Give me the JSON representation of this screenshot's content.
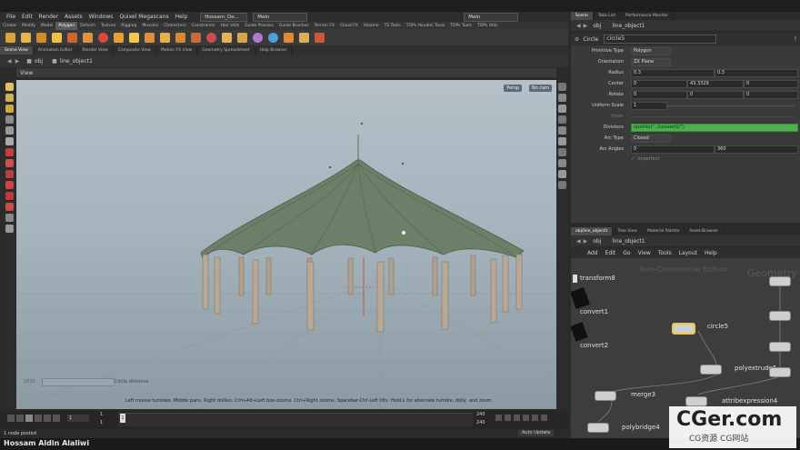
{
  "menu": {
    "items": [
      "File",
      "Edit",
      "Render",
      "Assets",
      "Windows",
      "Quixel Megascans",
      "Help"
    ],
    "scene_file": "Hossam_De...",
    "desktop": "Main",
    "search": "Main"
  },
  "shelf": {
    "tabs": [
      "Create",
      "Modify",
      "Model",
      "Polygon",
      "Deform",
      "Texture",
      "Rigging",
      "Muscles",
      "Characters",
      "Constraints",
      "Hair Utils",
      "Guide Process",
      "Guide Brushes",
      "Terrain FX",
      "Cloud FX",
      "Volume",
      "TS Tools",
      "TOPs Houdini Tools",
      "TOPs Tools",
      "TOPs Utils"
    ],
    "active_tab": 3
  },
  "panel_tabs": [
    "Scene View",
    "Animation Editor",
    "Render View",
    "Composite View",
    "Motion FX View",
    "Geometry Spreadsheet",
    "Help Browser"
  ],
  "viewport": {
    "path_root": "obj",
    "path_object": "line_object1",
    "view_label": "View",
    "persp_button": "Persp",
    "cam_button": "No cam",
    "status_hint": "Left mouse tumbles. Middle pans. Right dollies. Ctrl+Alt+Left box-zooms. Ctrl+Right zooms. Spacebar-Ctrl-Left tilts. Hold L for alternate tumble, dolly, and zoom.",
    "overlay_label": "Circle divisions",
    "overlay_value": "2020"
  },
  "timeline": {
    "current_frame": "1",
    "start_frame": "1",
    "end_frame": "1",
    "range_start": "1",
    "range_end": "240",
    "range_end2": "240",
    "status": "1 node posted",
    "auto_update": "Auto Update"
  },
  "parameters": {
    "tabs": [
      "Scene",
      "Take List",
      "Performance Monitor"
    ],
    "path_root": "obj",
    "path_object": "line_object1",
    "node_type": "Circle",
    "node_name": "circle5",
    "rows": [
      {
        "label": "Primitive Type",
        "value": "Polygon"
      },
      {
        "label": "Orientation",
        "value": "ZX Plane"
      },
      {
        "label": "Radius",
        "value": "0.3",
        "value2": "0.3"
      },
      {
        "label": "Center",
        "value": "0",
        "value2": "43.3329",
        "value3": "0"
      },
      {
        "label": "Rotate",
        "value": "0",
        "value2": "0",
        "value3": "0"
      },
      {
        "label": "Uniform Scale",
        "value": "1"
      },
      {
        "label": "Order",
        "value": ""
      },
      {
        "label": "Divisions",
        "value": "npoints(\"../convert2/\")"
      },
      {
        "label": "Arc Type",
        "value": "Closed"
      },
      {
        "label": "Arc Angles",
        "value": "0",
        "value2": "360"
      }
    ],
    "imperfect": "Imperfect"
  },
  "network": {
    "tabs": [
      "obj/line_object1",
      "Tree View",
      "Material Palette",
      "Asset Browser"
    ],
    "path_root": "obj",
    "path_object": "line_object1",
    "menu": [
      "Add",
      "Edit",
      "Go",
      "View",
      "Tools",
      "Layout",
      "Help"
    ],
    "watermark1": "Non-Commercial Edition",
    "watermark2": "Geometry",
    "nodes": [
      "transform8",
      "convert1",
      "convert2",
      "circle5",
      "polyextrude5",
      "merge3",
      "attribexpression4",
      "polybridge4"
    ]
  },
  "credit": "Hossam Aldin Alaliwi",
  "brand": {
    "name": "CGer.com",
    "subtitle": "CG资源 CG网站"
  },
  "colors": {
    "canopy": "#6d7f68",
    "pillar": "#b0a08e",
    "viewport_top": "#b5c0c8",
    "viewport_bottom": "#8c9aa3",
    "divisions_highlight": "#4caf50",
    "node_selected": "#e8c84a"
  }
}
